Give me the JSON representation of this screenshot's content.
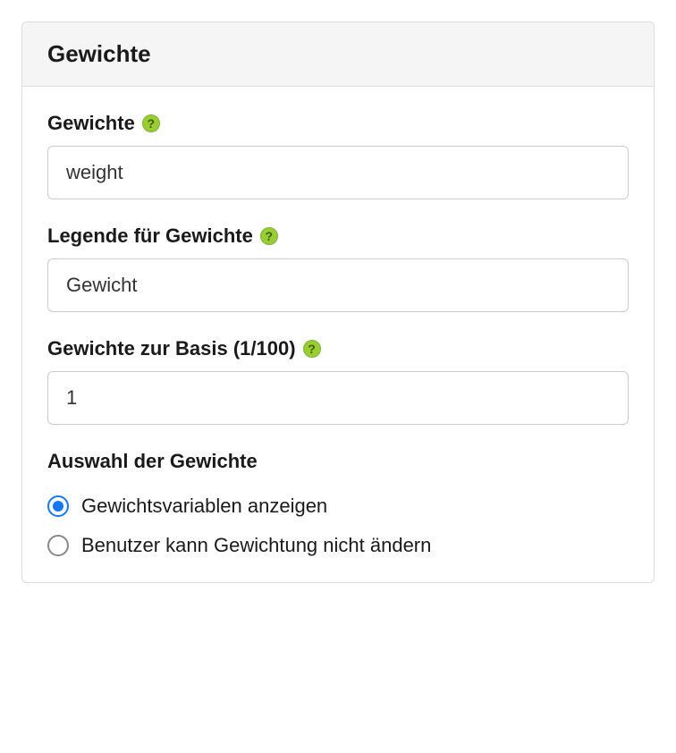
{
  "panel": {
    "title": "Gewichte"
  },
  "fields": {
    "gewichte": {
      "label": "Gewichte",
      "value": "weight"
    },
    "legende": {
      "label": "Legende für Gewichte",
      "value": "Gewicht"
    },
    "basis": {
      "label": "Gewichte zur Basis (1/100)",
      "value": "1"
    }
  },
  "selection": {
    "heading": "Auswahl der Gewichte",
    "options": {
      "show": "Gewichtsvariablen anzeigen",
      "lock": "Benutzer kann Gewichtung nicht ändern"
    },
    "selected": "show"
  }
}
